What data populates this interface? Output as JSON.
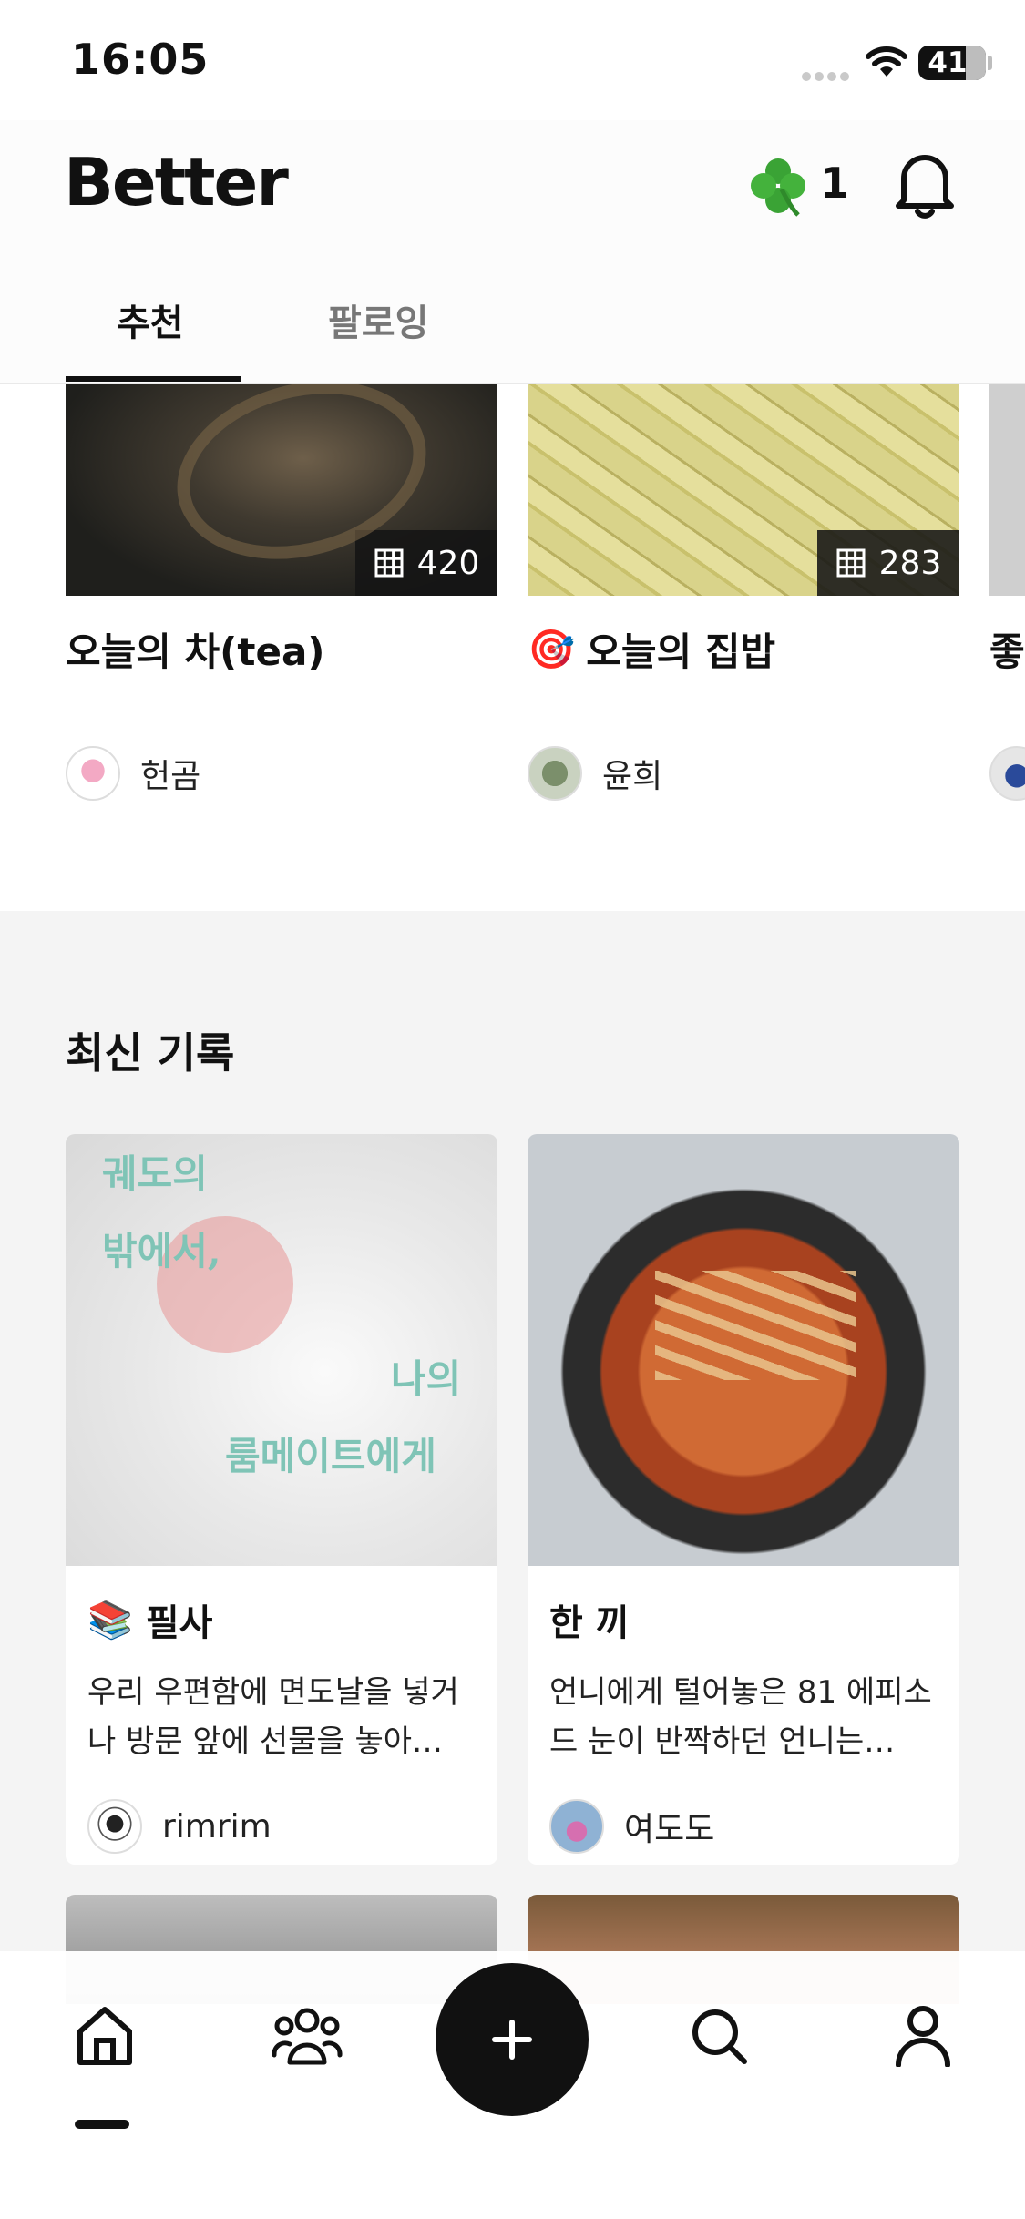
{
  "status_bar": {
    "time": "16:05",
    "battery": "41"
  },
  "header": {
    "logo": "Better",
    "clover_count": "1",
    "tabs": [
      {
        "label": "추천",
        "active": true
      },
      {
        "label": "팔로잉",
        "active": false
      }
    ]
  },
  "carousel": [
    {
      "count": "420",
      "title": "오늘의 차(tea)",
      "emoji": "",
      "author": "헌곰"
    },
    {
      "count": "283",
      "title": "오늘의 집밥",
      "emoji": "🎯",
      "author": "윤희"
    },
    {
      "title": "좋"
    }
  ],
  "latest": {
    "title": "최신 기록",
    "book_cover_text": [
      "궤도의",
      "밖에서,",
      "나의",
      "룸메이트에게"
    ],
    "posts": [
      {
        "emoji": "📚",
        "title": "필사",
        "excerpt": "우리 우편함에 면도날을 넣거나 방문 앞에 선물을 놓아…",
        "author": "rimrim"
      },
      {
        "emoji": "",
        "title": "한 끼",
        "excerpt": "언니에게 털어놓은 81 에피소드 눈이 반짝하던 언니는…",
        "author": "여도도"
      }
    ]
  },
  "bottom_nav": {
    "items": [
      "home-icon",
      "people-icon",
      "plus-icon",
      "search-icon",
      "profile-icon"
    ]
  },
  "colors": {
    "accent": "#111111",
    "section_bg": "#f4f4f4",
    "book_text": "#7fc4b6"
  }
}
